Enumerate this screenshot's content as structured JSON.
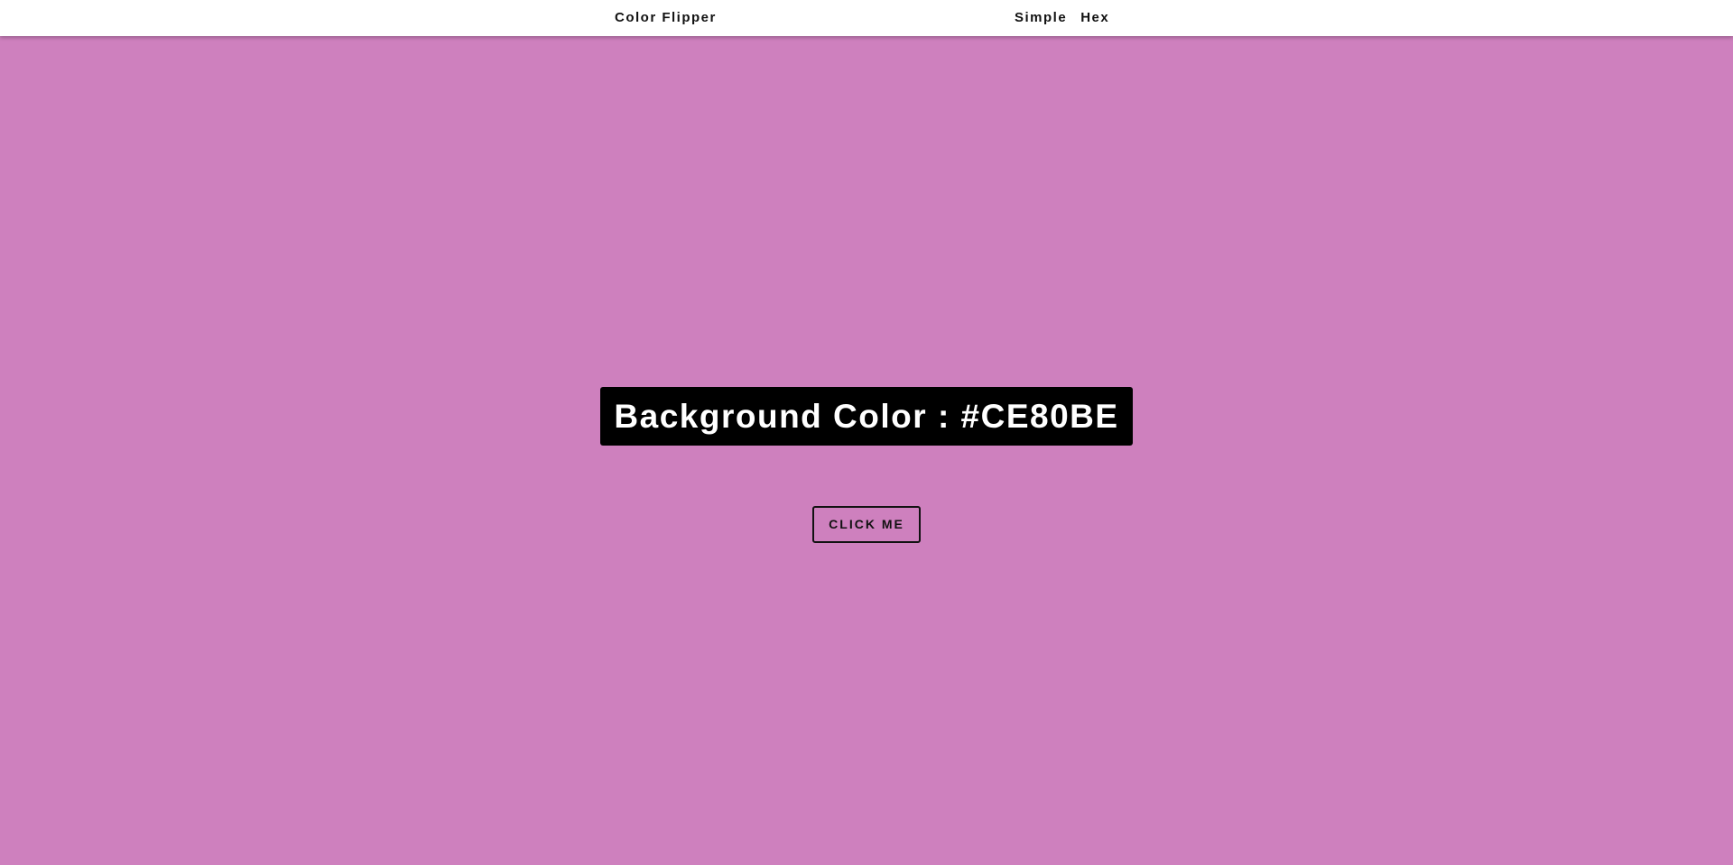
{
  "navbar": {
    "brand": "Color Flipper",
    "links": [
      {
        "label": "Simple"
      },
      {
        "label": "Hex"
      }
    ]
  },
  "main": {
    "heading_label": "Background Color : ",
    "color_value": "#CE80BE",
    "button_label": "CLICK ME"
  },
  "colors": {
    "background": "#CE80BE",
    "navbar": "#FFFFFF",
    "heading_bg": "#000000",
    "heading_text": "#FFFFFF"
  }
}
